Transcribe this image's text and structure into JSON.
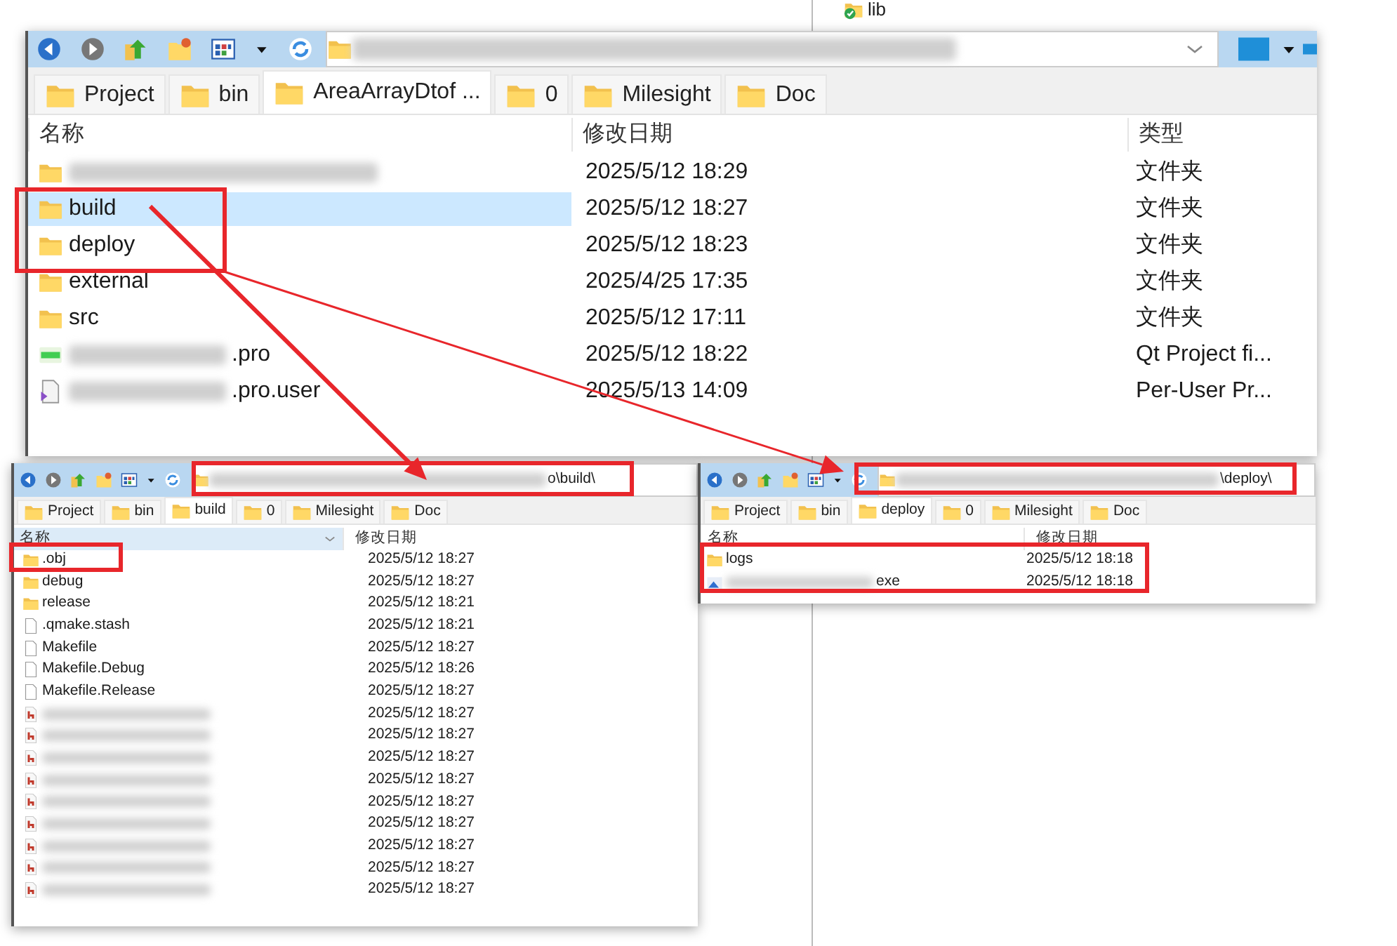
{
  "background_window": {
    "items": [
      {
        "name": "lib"
      }
    ]
  },
  "windows": [
    {
      "kind": "main",
      "address": {
        "redacted": true
      },
      "tabs": [
        {
          "label": "Project",
          "selected": false
        },
        {
          "label": "bin",
          "selected": false
        },
        {
          "label": "AreaArrayDtof ...",
          "selected": true
        },
        {
          "label": "0",
          "selected": false
        },
        {
          "label": "Milesight",
          "selected": false
        },
        {
          "label": "Doc",
          "selected": false
        }
      ],
      "columns": [
        "名称",
        "修改日期",
        "类型"
      ],
      "rows": [
        {
          "kind": "folder",
          "redacted": true,
          "date": "2025/5/12 18:29",
          "type": "文件夹",
          "selected": false
        },
        {
          "kind": "folder",
          "name": "build",
          "date": "2025/5/12 18:27",
          "type": "文件夹",
          "selected": true
        },
        {
          "kind": "folder",
          "name": "deploy",
          "date": "2025/5/12 18:23",
          "type": "文件夹",
          "selected": false
        },
        {
          "kind": "folder",
          "name": "external",
          "date": "2025/4/25 17:35",
          "type": "文件夹",
          "selected": false
        },
        {
          "kind": "folder",
          "name": "src",
          "date": "2025/5/12 17:11",
          "type": "文件夹",
          "selected": false
        },
        {
          "kind": "pro",
          "redacted": true,
          "name": ".pro",
          "date": "2025/5/12 18:22",
          "type": "Qt Project fi...",
          "selected": false
        },
        {
          "kind": "user",
          "redacted": true,
          "name": ".pro.user",
          "date": "2025/5/13 14:09",
          "type": "Per-User Pr...",
          "selected": false
        }
      ]
    },
    {
      "kind": "left",
      "address": {
        "redacted": true,
        "value": "o\\build\\"
      },
      "tabs": [
        {
          "label": "Project",
          "selected": false
        },
        {
          "label": "bin",
          "selected": false
        },
        {
          "label": "build",
          "selected": true
        },
        {
          "label": "0",
          "selected": false
        },
        {
          "label": "Milesight",
          "selected": false
        },
        {
          "label": "Doc",
          "selected": false
        }
      ],
      "columns": [
        "名称",
        "修改日期"
      ],
      "rows": [
        {
          "kind": "folder",
          "name": ".obj",
          "date": "2025/5/12 18:27",
          "selected": false
        },
        {
          "kind": "folder",
          "name": "debug",
          "date": "2025/5/12 18:27",
          "selected": false
        },
        {
          "kind": "folder",
          "name": "release",
          "date": "2025/5/12 18:21",
          "selected": false
        },
        {
          "kind": "file",
          "name": ".qmake.stash",
          "date": "2025/5/12 18:21",
          "selected": false
        },
        {
          "kind": "file",
          "name": "Makefile",
          "date": "2025/5/12 18:27",
          "selected": false
        },
        {
          "kind": "file",
          "name": "Makefile.Debug",
          "date": "2025/5/12 18:26",
          "selected": false
        },
        {
          "kind": "file",
          "name": "Makefile.Release",
          "date": "2025/5/12 18:27",
          "selected": false
        },
        {
          "kind": "header",
          "redacted": true,
          "date": "2025/5/12 18:27",
          "selected": false
        },
        {
          "kind": "header",
          "redacted": true,
          "date": "2025/5/12 18:27",
          "selected": false
        },
        {
          "kind": "header",
          "redacted": true,
          "date": "2025/5/12 18:27",
          "selected": false
        },
        {
          "kind": "header",
          "redacted": true,
          "date": "2025/5/12 18:27",
          "selected": false
        },
        {
          "kind": "header",
          "redacted": true,
          "date": "2025/5/12 18:27",
          "selected": false
        },
        {
          "kind": "header",
          "redacted": true,
          "date": "2025/5/12 18:27",
          "selected": false
        },
        {
          "kind": "header",
          "redacted": true,
          "date": "2025/5/12 18:27",
          "selected": false
        },
        {
          "kind": "header",
          "redacted": true,
          "date": "2025/5/12 18:27",
          "selected": false
        },
        {
          "kind": "header",
          "redacted": true,
          "date": "2025/5/12 18:27",
          "selected": false
        }
      ]
    },
    {
      "kind": "right",
      "address": {
        "redacted": true,
        "value": "\\deploy\\"
      },
      "tabs": [
        {
          "label": "Project",
          "selected": false
        },
        {
          "label": "bin",
          "selected": false
        },
        {
          "label": "deploy",
          "selected": true
        },
        {
          "label": "0",
          "selected": false
        },
        {
          "label": "Milesight",
          "selected": false
        },
        {
          "label": "Doc",
          "selected": false
        }
      ],
      "columns": [
        "名称",
        "修改日期"
      ],
      "rows": [
        {
          "kind": "folder",
          "name": "logs",
          "date": "2025/5/12 18:18",
          "selected": false
        },
        {
          "kind": "exe",
          "redacted": true,
          "name": "exe",
          "date": "2025/5/12 18:18",
          "selected": false
        }
      ]
    }
  ],
  "annotations": [
    {
      "kind": "box"
    },
    {
      "kind": "box"
    },
    {
      "kind": "box"
    },
    {
      "kind": "box"
    },
    {
      "kind": "box"
    },
    {
      "kind": "arrow"
    },
    {
      "kind": "arrow"
    }
  ]
}
